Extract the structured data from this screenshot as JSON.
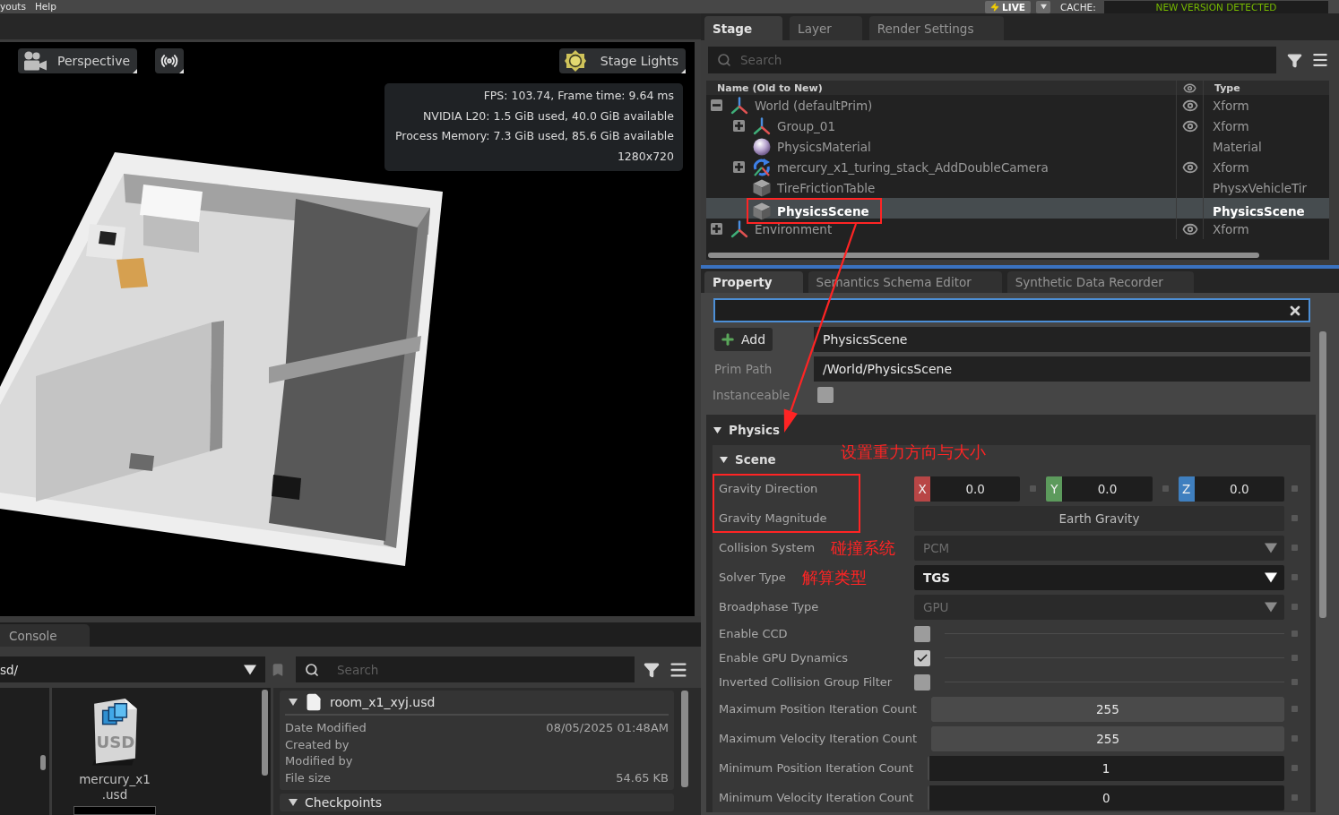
{
  "menu_bar": {
    "menus": [
      "youts",
      "Help"
    ],
    "live_button": "LIVE",
    "cache_label": "CACHE:",
    "cache_status": "NEW VERSION DETECTED"
  },
  "viewport": {
    "camera_button": "Perspective",
    "lights_button": "Stage Lights",
    "stats": [
      "FPS: 103.74, Frame time: 9.64 ms",
      "NVIDIA L20: 1.5 GiB used, 40.0 GiB available",
      "Process Memory: 7.3 GiB used, 85.6 GiB available",
      "1280x720"
    ]
  },
  "stage": {
    "tabs": [
      {
        "label": "Stage",
        "selected": true
      },
      {
        "label": "Layer",
        "selected": false
      },
      {
        "label": "Render Settings",
        "selected": false
      }
    ],
    "search": {
      "placeholder": "Search"
    },
    "columns": {
      "name": "Name (Old to New)",
      "type": "Type"
    },
    "tree": [
      {
        "name": "World (defaultPrim)",
        "type": "Xform",
        "kind": "xform",
        "visible_toggle": true,
        "expandable": true,
        "expanded": true,
        "selected": false,
        "outlined": false,
        "children": [
          {
            "name": "Group_01",
            "type": "Xform",
            "kind": "xform",
            "visible_toggle": true,
            "expandable": true,
            "expanded": false,
            "selected": false,
            "outlined": false
          },
          {
            "name": "PhysicsMaterial",
            "type": "Material",
            "kind": "material",
            "visible_toggle": false,
            "expandable": false,
            "selected": false,
            "outlined": false
          },
          {
            "name": "mercury_x1_turing_stack_AddDoubleCamera",
            "type": "Xform",
            "kind": "robot",
            "visible_toggle": true,
            "expandable": true,
            "expanded": false,
            "selected": false,
            "outlined": false
          },
          {
            "name": "TireFrictionTable",
            "type": "PhysxVehicleTir",
            "kind": "cube",
            "visible_toggle": false,
            "expandable": false,
            "selected": false,
            "outlined": false
          },
          {
            "name": "PhysicsScene",
            "type": "PhysicsScene",
            "kind": "cube",
            "visible_toggle": false,
            "expandable": false,
            "selected": true,
            "outlined": true
          }
        ]
      },
      {
        "name": "Environment",
        "type": "Xform",
        "kind": "xform",
        "visible_toggle": true,
        "expandable": true,
        "expanded": false,
        "selected": false,
        "outlined": false
      }
    ]
  },
  "property": {
    "tabs": [
      {
        "label": "Property",
        "selected": true
      },
      {
        "label": "Semantics Schema Editor",
        "selected": false
      },
      {
        "label": "Synthetic Data Recorder",
        "selected": false
      }
    ],
    "add_button": "Add",
    "name_field": "PhysicsScene",
    "prim_path": {
      "label": "Prim Path",
      "value": "/World/PhysicsScene"
    },
    "instanceable": {
      "label": "Instanceable",
      "checked": false
    },
    "sections": [
      {
        "title": "Physics",
        "expanded": true,
        "groups": [
          {
            "title": "Scene",
            "expanded": true,
            "note": "设置重力方向与大小",
            "properties": [
              {
                "kind": "vector",
                "label": "Gravity Direction",
                "outlined": true,
                "components": [
                  {
                    "axis": "X",
                    "value": "0.0",
                    "color": "#b84646"
                  },
                  {
                    "axis": "Y",
                    "value": "0.0",
                    "color": "#5c9a5c"
                  },
                  {
                    "axis": "Z",
                    "value": "0.0",
                    "color": "#3f7fbf"
                  }
                ]
              },
              {
                "kind": "text",
                "label": "Gravity Magnitude",
                "outlined": true,
                "value": "Earth Gravity"
              },
              {
                "kind": "dropdown",
                "label": "Collision System",
                "outlined": false,
                "note": "碰撞系统",
                "value": "PCM",
                "disabled": true
              },
              {
                "kind": "dropdown",
                "label": "Solver Type",
                "outlined": false,
                "note": "解算类型",
                "value": "TGS",
                "disabled": false
              },
              {
                "kind": "dropdown",
                "label": "Broadphase Type",
                "outlined": false,
                "value": "GPU",
                "disabled": true
              },
              {
                "kind": "checkbox",
                "label": "Enable CCD",
                "outlined": false,
                "checked": false
              },
              {
                "kind": "checkbox",
                "label": "Enable GPU Dynamics",
                "outlined": false,
                "checked": true
              },
              {
                "kind": "checkbox",
                "label": "Inverted Collision Group Filter",
                "outlined": false,
                "checked": false
              },
              {
                "kind": "slider",
                "label": "Maximum Position Iteration Count",
                "outlined": false,
                "value": "255",
                "level": 1
              },
              {
                "kind": "slider",
                "label": "Maximum Velocity Iteration Count",
                "outlined": false,
                "value": "255",
                "level": 1
              },
              {
                "kind": "slider",
                "label": "Minimum Position Iteration Count",
                "outlined": false,
                "value": "1",
                "level": 0
              },
              {
                "kind": "slider",
                "label": "Minimum Velocity Iteration Count",
                "outlined": false,
                "value": "0",
                "level": 0
              }
            ]
          }
        ]
      }
    ]
  },
  "content_browser": {
    "tabs": [
      {
        "label": "Console",
        "selected": true
      }
    ],
    "path": "sd/",
    "search": {
      "placeholder": "Search"
    },
    "files": [
      {
        "name": "mercury_x1.usd",
        "badge": "USD"
      }
    ],
    "details": {
      "file_name": "room_x1_xyj.usd",
      "expanded": true,
      "fields": [
        {
          "label": "Date Modified",
          "value": "08/05/2025 01:48AM"
        },
        {
          "label": "Created by"
        },
        {
          "label": "Modified by"
        },
        {
          "label": "File size",
          "value": "54.65 KB"
        }
      ]
    },
    "sections": [
      {
        "title": "Checkpoints",
        "expanded": true
      }
    ]
  }
}
